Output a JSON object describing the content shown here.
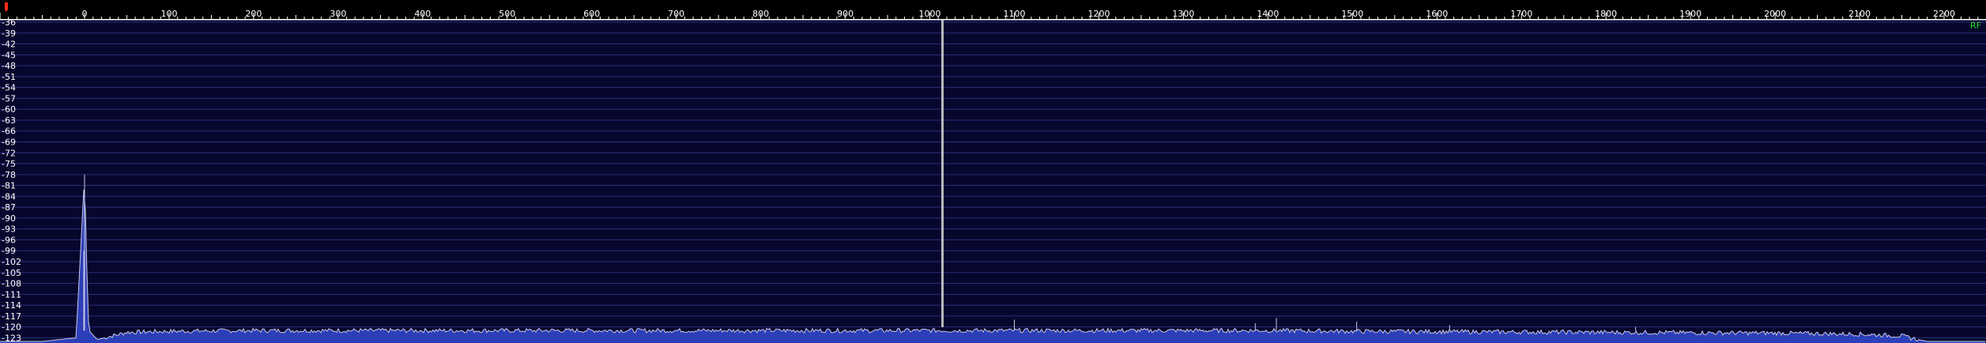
{
  "app": {
    "mode_label": "RF"
  },
  "colors": {
    "background": "#07072d",
    "scale_background": "#000000",
    "grid": "#2c2c7a",
    "trace": "#c8c8e6",
    "fill": "#2c3fb8",
    "label": "#ffffff",
    "marker": "#ff2a1a",
    "mode_label": "#22dd22",
    "cursor": "#d8d8d8"
  },
  "icons": {
    "tuning_marker": "tuning-marker-icon"
  },
  "cursor": {
    "frequency": 1015
  },
  "chart_data": {
    "type": "line",
    "x_axis": {
      "range": [
        -100,
        2250
      ],
      "tick_labels": [
        "0",
        "100",
        "200",
        "300",
        "400",
        "500",
        "600",
        "700",
        "800",
        "900",
        "1000",
        "1100",
        "1200",
        "1300",
        "1400",
        "1500",
        "1600",
        "1700",
        "1800",
        "1900",
        "2000",
        "2100",
        "2200"
      ],
      "tick_values": [
        0,
        100,
        200,
        300,
        400,
        500,
        600,
        700,
        800,
        900,
        1000,
        1100,
        1200,
        1300,
        1400,
        1500,
        1600,
        1700,
        1800,
        1900,
        2000,
        2100,
        2200
      ]
    },
    "y_axis": {
      "range": [
        -124,
        -36
      ],
      "tick_labels": [
        "-36",
        "-39",
        "-42",
        "-45",
        "-48",
        "-51",
        "-54",
        "-57",
        "-60",
        "-63",
        "-66",
        "-69",
        "-72",
        "-75",
        "-78",
        "-81",
        "-84",
        "-87",
        "-90",
        "-93",
        "-96",
        "-99",
        "-102",
        "-105",
        "-108",
        "-111",
        "-114",
        "-117",
        "-120",
        "-123"
      ],
      "tick_values": [
        -36,
        -39,
        -42,
        -45,
        -48,
        -51,
        -54,
        -57,
        -60,
        -63,
        -66,
        -69,
        -72,
        -75,
        -78,
        -81,
        -84,
        -87,
        -90,
        -93,
        -96,
        -99,
        -102,
        -105,
        -108,
        -111,
        -114,
        -117,
        -120,
        -123
      ]
    },
    "grid": true,
    "series": [
      {
        "x": [
          -100,
          -50,
          -10,
          0,
          2,
          5,
          15,
          50,
          100,
          200,
          300,
          400,
          500,
          600,
          700,
          800,
          900,
          1000,
          1010,
          1015,
          1020,
          1100,
          1200,
          1300,
          1400,
          1500,
          1600,
          1700,
          1800,
          1900,
          2000,
          2100,
          2150,
          2180,
          2200,
          2250
        ],
        "y": [
          -124,
          -124,
          -123,
          -78,
          -99,
          -121,
          -123.5,
          -121.5,
          -121.2,
          -121,
          -121,
          -121,
          -121,
          -121,
          -121,
          -121,
          -121,
          -121,
          -121,
          -121,
          -121,
          -121,
          -121,
          -121,
          -121,
          -121.2,
          -121.3,
          -121.4,
          -121.5,
          -121.6,
          -121.7,
          -122,
          -122.5,
          -124,
          -124,
          -124
        ]
      }
    ],
    "peaks": [
      {
        "x": 0,
        "y": -78
      },
      {
        "x": 1100,
        "y": -118
      },
      {
        "x": 1385,
        "y": -119
      },
      {
        "x": 1410,
        "y": -117.5
      },
      {
        "x": 1505,
        "y": -118.5
      },
      {
        "x": 1615,
        "y": -119.5
      },
      {
        "x": 1835,
        "y": -120
      }
    ]
  }
}
